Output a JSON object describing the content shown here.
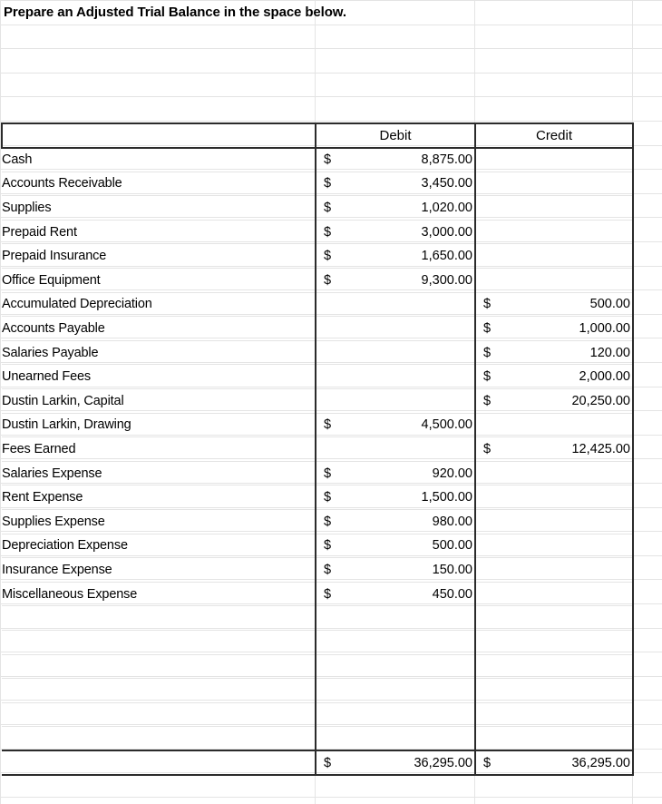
{
  "document": {
    "type": "spreadsheet-worksheet",
    "title": "Prepare an Adjusted Trial Balance in the space below."
  },
  "table": {
    "columns": {
      "account_header": "",
      "debit_header": "Debit",
      "credit_header": "Credit"
    },
    "currency_symbol": "$",
    "rows": [
      {
        "account": "Cash",
        "debit": "8,875.00",
        "credit": ""
      },
      {
        "account": "Accounts Receivable",
        "debit": "3,450.00",
        "credit": ""
      },
      {
        "account": "Supplies",
        "debit": "1,020.00",
        "credit": ""
      },
      {
        "account": "Prepaid Rent",
        "debit": "3,000.00",
        "credit": ""
      },
      {
        "account": "Prepaid Insurance",
        "debit": "1,650.00",
        "credit": ""
      },
      {
        "account": "Office Equipment",
        "debit": "9,300.00",
        "credit": ""
      },
      {
        "account": "Accumulated Depreciation",
        "debit": "",
        "credit": "500.00"
      },
      {
        "account": "Accounts Payable",
        "debit": "",
        "credit": "1,000.00"
      },
      {
        "account": "Salaries Payable",
        "debit": "",
        "credit": "120.00"
      },
      {
        "account": "Unearned Fees",
        "debit": "",
        "credit": "2,000.00"
      },
      {
        "account": "Dustin Larkin, Capital",
        "debit": "",
        "credit": "20,250.00"
      },
      {
        "account": "Dustin Larkin, Drawing",
        "debit": "4,500.00",
        "credit": ""
      },
      {
        "account": "Fees Earned",
        "debit": "",
        "credit": "12,425.00"
      },
      {
        "account": "Salaries Expense",
        "debit": "920.00",
        "credit": ""
      },
      {
        "account": "Rent Expense",
        "debit": "1,500.00",
        "credit": ""
      },
      {
        "account": "Supplies Expense",
        "debit": "980.00",
        "credit": ""
      },
      {
        "account": "Depreciation Expense",
        "debit": "500.00",
        "credit": ""
      },
      {
        "account": "Insurance Expense",
        "debit": "150.00",
        "credit": ""
      },
      {
        "account": "Miscellaneous Expense",
        "debit": "450.00",
        "credit": ""
      },
      {
        "account": "",
        "debit": "",
        "credit": ""
      },
      {
        "account": "",
        "debit": "",
        "credit": ""
      },
      {
        "account": "",
        "debit": "",
        "credit": ""
      },
      {
        "account": "",
        "debit": "",
        "credit": ""
      },
      {
        "account": "",
        "debit": "",
        "credit": ""
      },
      {
        "account": "",
        "debit": "",
        "credit": ""
      }
    ],
    "totals": {
      "account": "",
      "debit": "36,295.00",
      "credit": "36,295.00"
    }
  },
  "colors": {
    "gridline": "#e4e4e4",
    "table_border": "#2b2b2b",
    "text": "#000000",
    "background": "#ffffff"
  }
}
